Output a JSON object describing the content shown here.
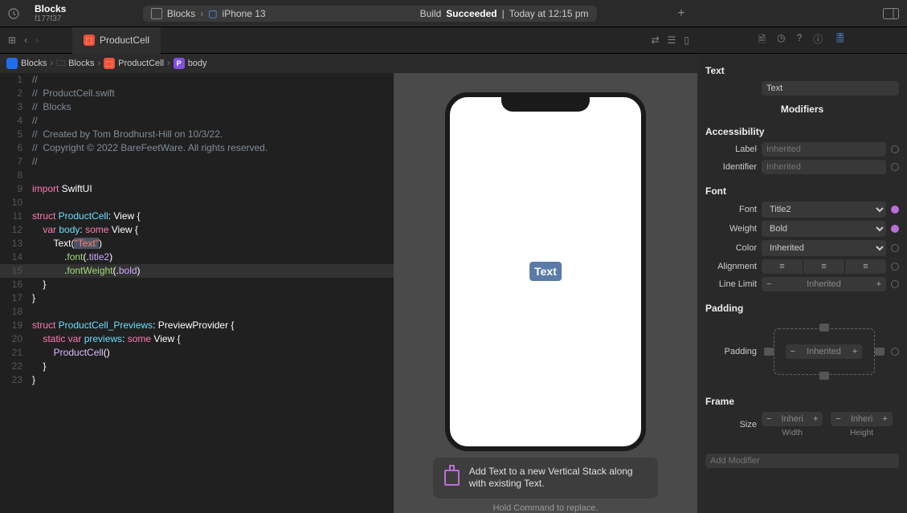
{
  "project": {
    "name": "Blocks",
    "commit": "f177f37"
  },
  "build": {
    "scheme": "Blocks",
    "device": "iPhone 13",
    "status_prefix": "Build",
    "status_word": "Succeeded",
    "time": "Today at 12:15 pm"
  },
  "tab": {
    "name": "ProductCell"
  },
  "breadcrumb": [
    "Blocks",
    "Blocks",
    "ProductCell",
    "body"
  ],
  "code": {
    "lines": [
      {
        "n": 1,
        "t": "comment",
        "s": "//"
      },
      {
        "n": 2,
        "t": "comment",
        "s": "//  ProductCell.swift"
      },
      {
        "n": 3,
        "t": "comment",
        "s": "//  Blocks"
      },
      {
        "n": 4,
        "t": "comment",
        "s": "//"
      },
      {
        "n": 5,
        "t": "comment",
        "s": "//  Created by Tom Brodhurst-Hill on 10/3/22."
      },
      {
        "n": 6,
        "t": "comment",
        "s": "//  Copyright © 2022 BareFeetWare. All rights reserved."
      },
      {
        "n": 7,
        "t": "comment",
        "s": "//"
      },
      {
        "n": 8,
        "t": "blank",
        "s": ""
      },
      {
        "n": 9,
        "t": "import",
        "kw": "import",
        "id": " SwiftUI"
      },
      {
        "n": 10,
        "t": "blank",
        "s": ""
      },
      {
        "n": 11,
        "t": "struct1",
        "kw": "struct ",
        "name": "ProductCell",
        "rest": ": View {"
      },
      {
        "n": 12,
        "t": "var1",
        "indent": "    ",
        "kw": "var ",
        "name": "body",
        "colon": ": ",
        "some": "some",
        "rest": " View {"
      },
      {
        "n": 13,
        "t": "text",
        "indent": "        ",
        "fn": "Text",
        "open": "(",
        "str": "\"Text\"",
        "close": ")"
      },
      {
        "n": 14,
        "t": "mod",
        "indent": "            ",
        "dot": ".",
        "m": "font",
        "open": "(.",
        "arg": "title2",
        "close": ")"
      },
      {
        "n": 15,
        "t": "mod",
        "hl": true,
        "indent": "            ",
        "dot": ".",
        "m": "fontWeight",
        "open": "(.",
        "arg": "bold",
        "close": ")"
      },
      {
        "n": 16,
        "t": "brace",
        "s": "    }"
      },
      {
        "n": 17,
        "t": "brace",
        "s": "}"
      },
      {
        "n": 18,
        "t": "blank",
        "s": ""
      },
      {
        "n": 19,
        "t": "struct2",
        "kw": "struct ",
        "name": "ProductCell_Previews",
        "rest": ": PreviewProvider {"
      },
      {
        "n": 20,
        "t": "var2",
        "indent": "    ",
        "kw": "static var ",
        "name": "previews",
        "colon": ": ",
        "some": "some",
        "rest": " View {"
      },
      {
        "n": 21,
        "t": "call",
        "indent": "        ",
        "id": "ProductCell",
        "rest": "()"
      },
      {
        "n": 22,
        "t": "brace",
        "s": "    }"
      },
      {
        "n": 23,
        "t": "brace",
        "s": "}"
      }
    ]
  },
  "preview": {
    "text": "Text",
    "hint": "Add Text to a new Vertical Stack along with existing Text.",
    "hint2": "Hold Command to replace."
  },
  "inspector": {
    "section_text": "Text",
    "text_value": "Text",
    "modifiers": "Modifiers",
    "accessibility": {
      "title": "Accessibility",
      "label": "Label",
      "label_ph": "Inherited",
      "identifier": "Identifier",
      "id_ph": "Inherited"
    },
    "font": {
      "title": "Font",
      "font": "Font",
      "font_val": "Title2",
      "weight": "Weight",
      "weight_val": "Bold",
      "color": "Color",
      "color_val": "Inherited",
      "alignment": "Alignment",
      "linelimit": "Line Limit",
      "linelimit_val": "Inherited"
    },
    "padding": {
      "title": "Padding",
      "label": "Padding",
      "val": "Inherited"
    },
    "frame": {
      "title": "Frame",
      "size": "Size",
      "width_val": "Inheri",
      "width_lbl": "Width",
      "height_val": "Inheri",
      "height_lbl": "Height"
    },
    "add_modifier_ph": "Add Modifier"
  }
}
